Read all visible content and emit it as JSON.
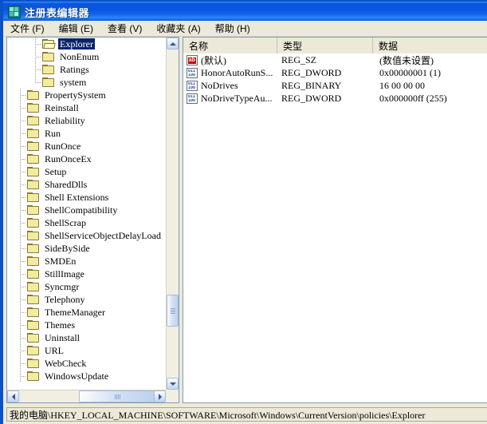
{
  "window": {
    "title": "注册表编辑器",
    "icon": "registry-editor-icon"
  },
  "menubar": {
    "items": [
      {
        "label": "文件 (F)",
        "name": "menu-file"
      },
      {
        "label": "编辑 (E)",
        "name": "menu-edit"
      },
      {
        "label": "查看 (V)",
        "name": "menu-view"
      },
      {
        "label": "收藏夹 (A)",
        "name": "menu-favorites"
      },
      {
        "label": "帮助 (H)",
        "name": "menu-help"
      }
    ]
  },
  "tree": {
    "items": [
      {
        "label": "Explorer",
        "depth": 2,
        "selected": true,
        "open": true,
        "connector": "tee"
      },
      {
        "label": "NonEnum",
        "depth": 2,
        "selected": false,
        "open": false,
        "connector": "tee"
      },
      {
        "label": "Ratings",
        "depth": 2,
        "selected": false,
        "open": false,
        "connector": "tee"
      },
      {
        "label": "system",
        "depth": 2,
        "selected": false,
        "open": false,
        "connector": "last"
      },
      {
        "label": "PropertySystem",
        "depth": 1,
        "selected": false,
        "open": false,
        "connector": "tee"
      },
      {
        "label": "Reinstall",
        "depth": 1,
        "selected": false,
        "open": false,
        "connector": "tee"
      },
      {
        "label": "Reliability",
        "depth": 1,
        "selected": false,
        "open": false,
        "connector": "tee"
      },
      {
        "label": "Run",
        "depth": 1,
        "selected": false,
        "open": false,
        "connector": "tee"
      },
      {
        "label": "RunOnce",
        "depth": 1,
        "selected": false,
        "open": false,
        "connector": "tee"
      },
      {
        "label": "RunOnceEx",
        "depth": 1,
        "selected": false,
        "open": false,
        "connector": "tee"
      },
      {
        "label": "Setup",
        "depth": 1,
        "selected": false,
        "open": false,
        "connector": "tee"
      },
      {
        "label": "SharedDlls",
        "depth": 1,
        "selected": false,
        "open": false,
        "connector": "tee"
      },
      {
        "label": "Shell Extensions",
        "depth": 1,
        "selected": false,
        "open": false,
        "connector": "tee"
      },
      {
        "label": "ShellCompatibility",
        "depth": 1,
        "selected": false,
        "open": false,
        "connector": "tee"
      },
      {
        "label": "ShellScrap",
        "depth": 1,
        "selected": false,
        "open": false,
        "connector": "tee"
      },
      {
        "label": "ShellServiceObjectDelayLoad",
        "depth": 1,
        "selected": false,
        "open": false,
        "connector": "tee"
      },
      {
        "label": "SideBySide",
        "depth": 1,
        "selected": false,
        "open": false,
        "connector": "tee"
      },
      {
        "label": "SMDEn",
        "depth": 1,
        "selected": false,
        "open": false,
        "connector": "tee"
      },
      {
        "label": "StillImage",
        "depth": 1,
        "selected": false,
        "open": false,
        "connector": "tee"
      },
      {
        "label": "Syncmgr",
        "depth": 1,
        "selected": false,
        "open": false,
        "connector": "tee"
      },
      {
        "label": "Telephony",
        "depth": 1,
        "selected": false,
        "open": false,
        "connector": "tee"
      },
      {
        "label": "ThemeManager",
        "depth": 1,
        "selected": false,
        "open": false,
        "connector": "tee"
      },
      {
        "label": "Themes",
        "depth": 1,
        "selected": false,
        "open": false,
        "connector": "tee"
      },
      {
        "label": "Uninstall",
        "depth": 1,
        "selected": false,
        "open": false,
        "connector": "tee"
      },
      {
        "label": "URL",
        "depth": 1,
        "selected": false,
        "open": false,
        "connector": "tee"
      },
      {
        "label": "WebCheck",
        "depth": 1,
        "selected": false,
        "open": false,
        "connector": "tee"
      },
      {
        "label": "WindowsUpdate",
        "depth": 1,
        "selected": false,
        "open": false,
        "connector": "tee"
      }
    ]
  },
  "list": {
    "columns": [
      "名称",
      "类型",
      "数据"
    ],
    "rows": [
      {
        "icon": "string-value-icon",
        "icon_kind": "str",
        "name": "(默认)",
        "type": "REG_SZ",
        "data": "(数值未设置)"
      },
      {
        "icon": "binary-value-icon",
        "icon_kind": "bin",
        "name": "HonorAutoRunS...",
        "type": "REG_DWORD",
        "data": "0x00000001  (1)"
      },
      {
        "icon": "binary-value-icon",
        "icon_kind": "bin",
        "name": "NoDrives",
        "type": "REG_BINARY",
        "data": "16 00 00 00"
      },
      {
        "icon": "binary-value-icon",
        "icon_kind": "bin",
        "name": "NoDriveTypeAu...",
        "type": "REG_DWORD",
        "data": "0x000000ff  (255)"
      }
    ]
  },
  "statusbar": {
    "path": "我的电脑\\HKEY_LOCAL_MACHINE\\SOFTWARE\\Microsoft\\Windows\\CurrentVersion\\policies\\Explorer"
  },
  "scrollbars": {
    "tree_vertical": {
      "up": "scroll-up-arrow",
      "down": "scroll-down-arrow"
    },
    "tree_horizontal": {
      "left": "scroll-left-arrow",
      "right": "scroll-right-arrow"
    }
  },
  "colors": {
    "titlebar_blue": "#0b57e0",
    "selection_blue": "#0a246a",
    "chrome_beige": "#ece9d8",
    "folder_yellow": "#f3eca0"
  }
}
